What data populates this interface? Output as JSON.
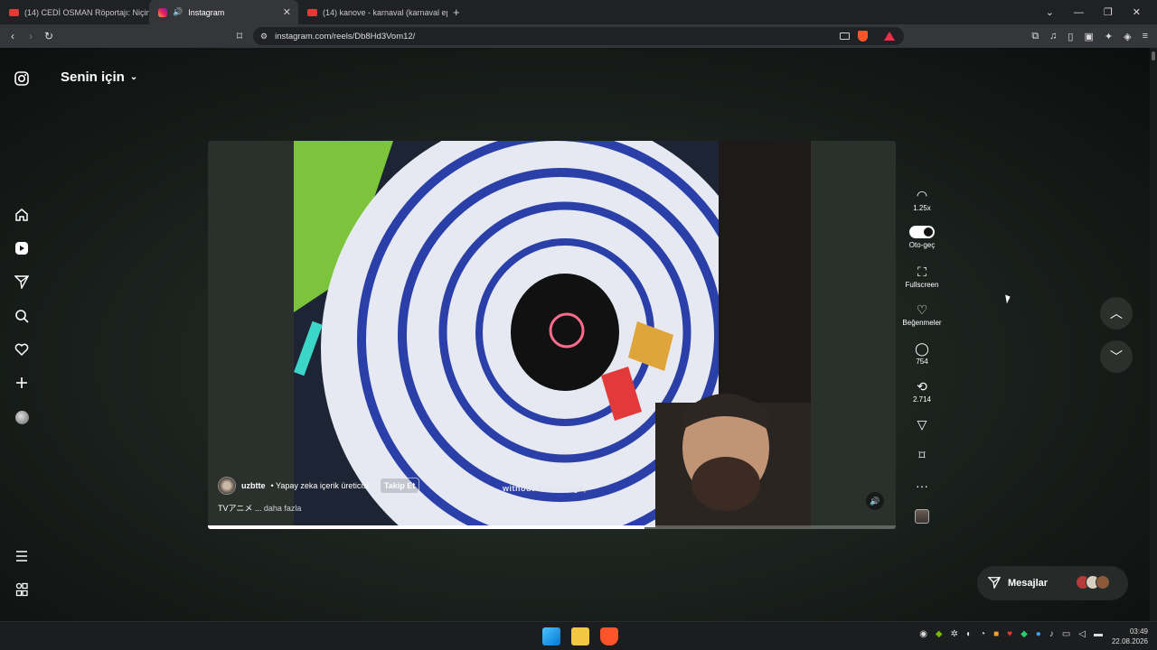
{
  "browser": {
    "tabs": [
      {
        "label": "(14) CEDİ OSMAN Röportajı: Niçin PA",
        "icon": "youtube-icon"
      },
      {
        "label": "Instagram",
        "icon": "instagram-icon",
        "active": true
      },
      {
        "label": "(14) kanove - karnaval (karnaval ep)",
        "icon": "youtube-icon"
      }
    ],
    "url": "instagram.com/reels/Db8Hd3Vom12/"
  },
  "header": {
    "feed_label": "Senin için"
  },
  "reel": {
    "username": "uzbtte",
    "user_subtitle": "• Yapay zeka içerik üreticisi",
    "follow_label": "Takip Et",
    "caption": "TVアニメ ...",
    "caption_more": "daha fazla",
    "subtitle_text": "without knowledge,",
    "progress_fraction": 0.635
  },
  "actions": {
    "speed": "1.25x",
    "autoplay_label": "Oto-geç",
    "autoplay_on": true,
    "fullscreen_label": "Fullscreen",
    "likes_label": "Beğenmeler",
    "comments_count": "754",
    "reposts_count": "2.714"
  },
  "messages": {
    "label": "Mesajlar"
  },
  "system": {
    "time": "03:49",
    "date": "22.08.2026"
  },
  "colors": {
    "accent_progress": "#ffffff",
    "background": "#0d0f0e"
  }
}
